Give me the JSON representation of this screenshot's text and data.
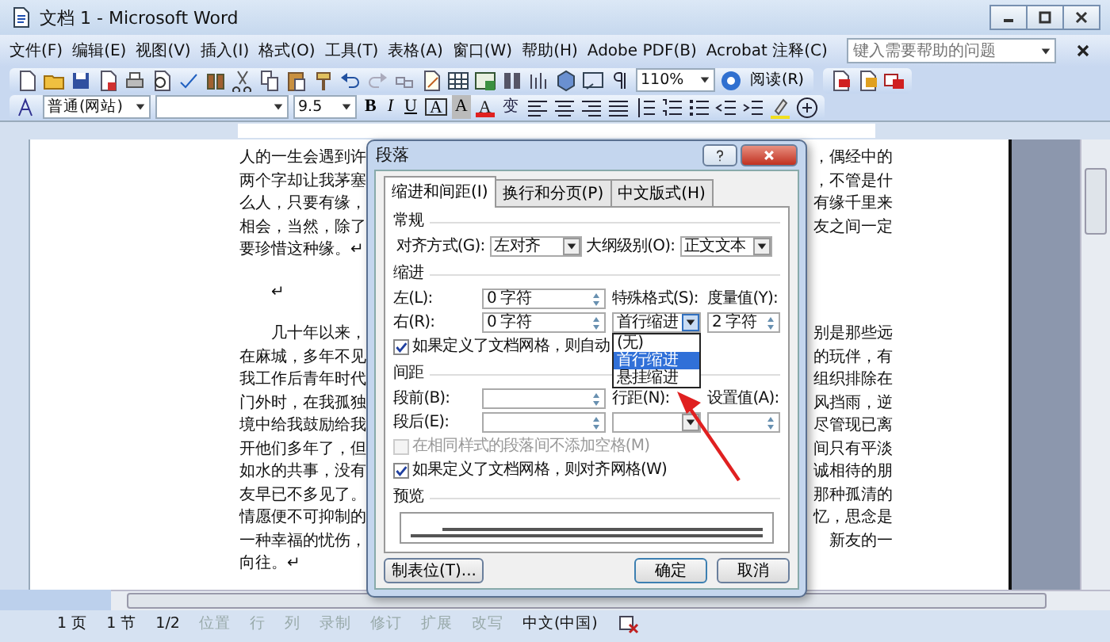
{
  "window": {
    "title": "文档 1 - Microsoft Word"
  },
  "menu": {
    "items": [
      "文件(F)",
      "编辑(E)",
      "视图(V)",
      "插入(I)",
      "格式(O)",
      "工具(T)",
      "表格(A)",
      "窗口(W)",
      "帮助(H)",
      "Adobe PDF(B)",
      "Acrobat 注释(C)"
    ],
    "help_search": {
      "placeholder": "键入需要帮助的问题"
    }
  },
  "standard_toolbar": {
    "zoom": "110%",
    "read_button": "阅读(R)"
  },
  "formatting_toolbar": {
    "style": "普通(网站)",
    "font_size": "9.5",
    "format_buttons": [
      "B",
      "I",
      "U",
      "A",
      "A",
      "A",
      "变"
    ]
  },
  "document": {
    "paragraphs": [
      {
        "indent": false,
        "lines": [
          {
            "left": "人的一生会遇到许",
            "right": "，偶经中的"
          },
          {
            "left": "两个字却让我茅塞",
            "right": "，不管是什"
          },
          {
            "left": "么人，只要有缘，",
            "right": "有缘千里来"
          },
          {
            "left": "相会，当然，除了",
            "right": "友之间一定"
          },
          {
            "left": "要珍惜这种缘。↵"
          }
        ]
      },
      {
        "indent": true,
        "lines": [
          {
            "left": "↵"
          }
        ]
      },
      {
        "indent": true,
        "lines": [
          {
            "left": "几十年以来，",
            "right": "别是那些远"
          },
          {
            "left": "在麻城，多年不见",
            "right": "的玩伴，有"
          },
          {
            "left": "我工作后青年时代",
            "right": "组织排除在"
          },
          {
            "left": "门外时，在我孤独",
            "right": "风挡雨，逆"
          },
          {
            "left": "境中给我鼓励给我",
            "right": "尽管现已离"
          },
          {
            "left": "开他们多年了，但",
            "right": "间只有平淡"
          },
          {
            "left": "如水的共事，没有",
            "right": "诚相待的朋"
          },
          {
            "left": "友早已不多见了。",
            "right": "那种孤清的"
          },
          {
            "left": "情愿便不可抑制的",
            "right": "忆，思念是"
          },
          {
            "left": "一种幸福的忧伤，",
            "right": "新友的一"
          },
          {
            "left": "向往。↵"
          }
        ]
      }
    ]
  },
  "dialog": {
    "title": "段落",
    "tabs": [
      {
        "label": "缩进和间距(I)",
        "selected": true
      },
      {
        "label": "换行和分页(P)",
        "selected": false
      },
      {
        "label": "中文版式(H)",
        "selected": false
      }
    ],
    "general": {
      "heading": "常规",
      "alignment": {
        "label": "对齐方式(G):",
        "value": "左对齐"
      },
      "outline_level": {
        "label": "大纲级别(O):",
        "value": "正文文本"
      }
    },
    "indentation": {
      "heading": "缩进",
      "left": {
        "label": "左(L):",
        "value": "0 字符"
      },
      "right": {
        "label": "右(R):",
        "value": "0 字符"
      },
      "special": {
        "label": "特殊格式(S):",
        "value": "首行缩进",
        "expanded": true,
        "options": [
          {
            "label": "(无)",
            "selected": false
          },
          {
            "label": "首行缩进",
            "selected": true
          },
          {
            "label": "悬挂缩进",
            "selected": false
          }
        ]
      },
      "by": {
        "label": "度量值(Y):",
        "value": "2 字符"
      },
      "grid_check": {
        "label": "如果定义了文档网格，则自动",
        "checked": true
      }
    },
    "spacing": {
      "heading": "间距",
      "before": {
        "label": "段前(B):"
      },
      "after": {
        "label": "段后(E):"
      },
      "line_spacing": {
        "label": "行距(N):"
      },
      "at": {
        "label": "设置值(A):"
      },
      "checks": [
        {
          "label": "在相同样式的段落间不添加空格(M)",
          "checked": false,
          "disabled": true
        },
        {
          "label": "如果定义了文档网格，则对齐网格(W)",
          "checked": true,
          "disabled": false
        }
      ]
    },
    "preview": {
      "heading": "预览"
    },
    "buttons": [
      {
        "label": "制表位(T)...",
        "kind": "tabs"
      },
      {
        "label": "确定",
        "kind": "ok"
      },
      {
        "label": "取消",
        "kind": "cancel"
      }
    ]
  },
  "status_bar": {
    "items": [
      {
        "text": "1 页",
        "disabled": false
      },
      {
        "text": "1 节",
        "disabled": false
      },
      {
        "text": "1/2",
        "disabled": false
      },
      {
        "text": "位置",
        "disabled": true
      },
      {
        "text": "行",
        "disabled": true
      },
      {
        "text": "列",
        "disabled": true
      },
      {
        "text": "录制",
        "disabled": true
      },
      {
        "text": "修订",
        "disabled": true
      },
      {
        "text": "扩展",
        "disabled": true
      },
      {
        "text": "改写",
        "disabled": true
      },
      {
        "text": "中文(中国)",
        "disabled": false
      }
    ]
  }
}
